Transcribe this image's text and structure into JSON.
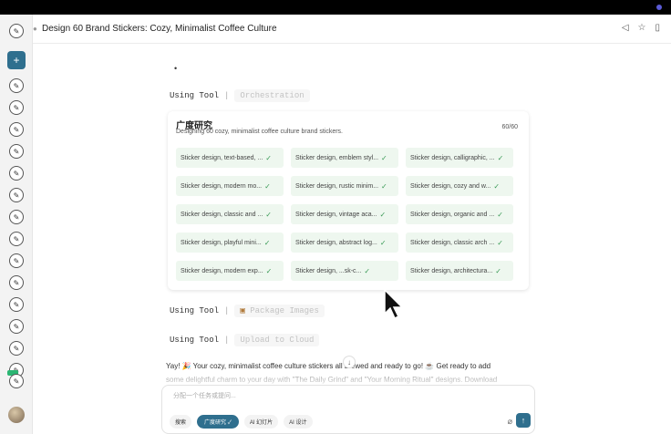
{
  "header": {
    "title": "Design 60 Brand Stickers: Cozy, Minimalist Coffee Culture"
  },
  "sidebar": {
    "new_label": "+"
  },
  "tools": [
    {
      "label": "Using Tool",
      "name": "Orchestration"
    },
    {
      "label": "Using Tool",
      "name": "Package Images"
    },
    {
      "label": "Using Tool",
      "name": "Upload to Cloud"
    }
  ],
  "card": {
    "title": "广度研究",
    "description": "Designing 60 cozy, minimalist coffee culture brand stickers.",
    "count": "60/60",
    "items": [
      "Sticker design, text-based, ...",
      "Sticker design, emblem styl...",
      "Sticker design, calligraphic, ...",
      "Sticker design, modern mo...",
      "Sticker design, rustic minim...",
      "Sticker design, cozy and w...",
      "Sticker design, classic and ...",
      "Sticker design, vintage aca...",
      "Sticker design, organic and ...",
      "Sticker design, playful mini...",
      "Sticker design, abstract log...",
      "Sticker design, classic arch ...",
      "Sticker design, modern exp...",
      "Sticker design, ...sk-c...",
      "Sticker design, architectura..."
    ]
  },
  "result": {
    "line1": "Yay! 🎉 Your cozy, minimalist coffee culture stickers    all brewed and ready to go! ☕  Get ready to add",
    "line2": "some delightful charm to your day with \"The Daily Grind\" and \"Your Morning Ritual\" designs. Download"
  },
  "composer": {
    "placeholder": "分配一个任务或提问...",
    "chips": [
      "搜索",
      "广度研究",
      "AI 幻灯片",
      "AI 设计"
    ]
  }
}
